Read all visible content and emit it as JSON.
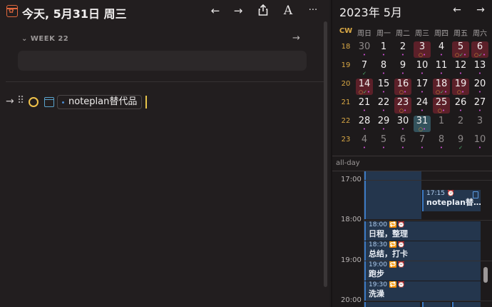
{
  "header": {
    "title": "今天, 5月31日 周三",
    "icons": [
      "calendar-star-icon",
      "arrow-left-icon",
      "arrow-right-icon",
      "share-icon",
      "font-icon",
      "more-icon"
    ],
    "back_glyph": "←",
    "forward_glyph": "→",
    "share_glyph": "⇪",
    "font_glyph": "A",
    "more_glyph": "···"
  },
  "week": {
    "label": "WEEK 22",
    "chevron": "⌄",
    "arrow": "→"
  },
  "task": {
    "arrow": "→",
    "grip": "⠿",
    "text": "noteplan替代品"
  },
  "calendar": {
    "title": "2023年 5月",
    "prev": "←",
    "next": "→",
    "headers": [
      "CW",
      "周日",
      "周一",
      "周二",
      "周三",
      "周四",
      "周五",
      "周六"
    ],
    "weeks": [
      {
        "cw": "18",
        "days": [
          {
            "d": "30",
            "o": true,
            "m": "•",
            "hl": false
          },
          {
            "d": "1",
            "m": "•"
          },
          {
            "d": "2",
            "m": "•"
          },
          {
            "d": "3",
            "m": "○•",
            "hl": true
          },
          {
            "d": "4",
            "m": "•"
          },
          {
            "d": "5",
            "m": "○✓•",
            "hl": true
          },
          {
            "d": "6",
            "m": "○✓•",
            "hl": true
          }
        ]
      },
      {
        "cw": "19",
        "days": [
          {
            "d": "7",
            "m": "✓"
          },
          {
            "d": "8",
            "m": "•"
          },
          {
            "d": "9",
            "m": "•"
          },
          {
            "d": "10",
            "m": "•"
          },
          {
            "d": "11",
            "m": "•"
          },
          {
            "d": "12",
            "m": "•"
          },
          {
            "d": "13",
            "m": "•"
          }
        ]
      },
      {
        "cw": "20",
        "days": [
          {
            "d": "14",
            "m": "○✓•",
            "hl": true
          },
          {
            "d": "15",
            "m": "•"
          },
          {
            "d": "16",
            "m": "○•",
            "hl": true
          },
          {
            "d": "17",
            "m": "•"
          },
          {
            "d": "18",
            "m": "○✓•",
            "hl": true
          },
          {
            "d": "19",
            "m": "○•",
            "hl": true
          },
          {
            "d": "20",
            "m": "•"
          }
        ]
      },
      {
        "cw": "21",
        "days": [
          {
            "d": "21",
            "m": "•"
          },
          {
            "d": "22",
            "m": "•"
          },
          {
            "d": "23",
            "m": "○•",
            "hl": true
          },
          {
            "d": "24",
            "m": "•"
          },
          {
            "d": "25",
            "m": "○•",
            "hl": true
          },
          {
            "d": "26",
            "m": "•"
          },
          {
            "d": "27",
            "m": "•"
          }
        ]
      },
      {
        "cw": "22",
        "days": [
          {
            "d": "28",
            "m": "•"
          },
          {
            "d": "29",
            "m": "•"
          },
          {
            "d": "30",
            "m": "•"
          },
          {
            "d": "31",
            "m": "○•",
            "today": true
          },
          {
            "d": "1",
            "o": true,
            "m": ""
          },
          {
            "d": "2",
            "o": true,
            "m": ""
          },
          {
            "d": "3",
            "o": true,
            "m": ""
          }
        ]
      },
      {
        "cw": "23",
        "days": [
          {
            "d": "4",
            "o": true,
            "m": "•"
          },
          {
            "d": "5",
            "o": true,
            "m": "•"
          },
          {
            "d": "6",
            "o": true,
            "m": "•"
          },
          {
            "d": "7",
            "o": true,
            "m": "•"
          },
          {
            "d": "8",
            "o": true,
            "m": "•"
          },
          {
            "d": "9",
            "o": true,
            "m": "✓"
          },
          {
            "d": "10",
            "o": true,
            "m": "•"
          }
        ]
      }
    ]
  },
  "allday_label": "all-day",
  "timeline": {
    "hours": [
      "17:00",
      "18:00",
      "19:00",
      "20:00"
    ],
    "events": [
      {
        "time": "17:15 ⏰",
        "title": "noteplan替…",
        "icon": "note-icon"
      },
      {
        "time": "18:00 🔁⏰",
        "title": "日程，整理"
      },
      {
        "time": "18:30 🔁⏰",
        "title": "总结，打卡"
      },
      {
        "time": "19:00 🔁⏰",
        "title": "跑步"
      },
      {
        "time": "19:30 🔁⏰",
        "title": "洗澡"
      }
    ]
  }
}
